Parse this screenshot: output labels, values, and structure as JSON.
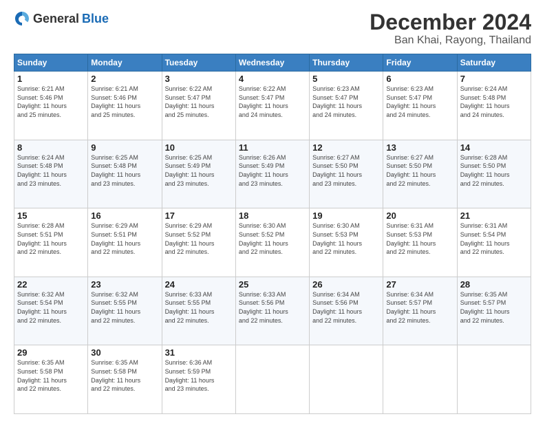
{
  "logo": {
    "general": "General",
    "blue": "Blue"
  },
  "header": {
    "month": "December 2024",
    "location": "Ban Khai, Rayong, Thailand"
  },
  "weekdays": [
    "Sunday",
    "Monday",
    "Tuesday",
    "Wednesday",
    "Thursday",
    "Friday",
    "Saturday"
  ],
  "weeks": [
    [
      {
        "day": "1",
        "sunrise": "6:21 AM",
        "sunset": "5:46 PM",
        "daylight": "11 hours and 25 minutes."
      },
      {
        "day": "2",
        "sunrise": "6:21 AM",
        "sunset": "5:46 PM",
        "daylight": "11 hours and 25 minutes."
      },
      {
        "day": "3",
        "sunrise": "6:22 AM",
        "sunset": "5:47 PM",
        "daylight": "11 hours and 25 minutes."
      },
      {
        "day": "4",
        "sunrise": "6:22 AM",
        "sunset": "5:47 PM",
        "daylight": "11 hours and 24 minutes."
      },
      {
        "day": "5",
        "sunrise": "6:23 AM",
        "sunset": "5:47 PM",
        "daylight": "11 hours and 24 minutes."
      },
      {
        "day": "6",
        "sunrise": "6:23 AM",
        "sunset": "5:47 PM",
        "daylight": "11 hours and 24 minutes."
      },
      {
        "day": "7",
        "sunrise": "6:24 AM",
        "sunset": "5:48 PM",
        "daylight": "11 hours and 24 minutes."
      }
    ],
    [
      {
        "day": "8",
        "sunrise": "6:24 AM",
        "sunset": "5:48 PM",
        "daylight": "11 hours and 23 minutes."
      },
      {
        "day": "9",
        "sunrise": "6:25 AM",
        "sunset": "5:48 PM",
        "daylight": "11 hours and 23 minutes."
      },
      {
        "day": "10",
        "sunrise": "6:25 AM",
        "sunset": "5:49 PM",
        "daylight": "11 hours and 23 minutes."
      },
      {
        "day": "11",
        "sunrise": "6:26 AM",
        "sunset": "5:49 PM",
        "daylight": "11 hours and 23 minutes."
      },
      {
        "day": "12",
        "sunrise": "6:27 AM",
        "sunset": "5:50 PM",
        "daylight": "11 hours and 23 minutes."
      },
      {
        "day": "13",
        "sunrise": "6:27 AM",
        "sunset": "5:50 PM",
        "daylight": "11 hours and 22 minutes."
      },
      {
        "day": "14",
        "sunrise": "6:28 AM",
        "sunset": "5:50 PM",
        "daylight": "11 hours and 22 minutes."
      }
    ],
    [
      {
        "day": "15",
        "sunrise": "6:28 AM",
        "sunset": "5:51 PM",
        "daylight": "11 hours and 22 minutes."
      },
      {
        "day": "16",
        "sunrise": "6:29 AM",
        "sunset": "5:51 PM",
        "daylight": "11 hours and 22 minutes."
      },
      {
        "day": "17",
        "sunrise": "6:29 AM",
        "sunset": "5:52 PM",
        "daylight": "11 hours and 22 minutes."
      },
      {
        "day": "18",
        "sunrise": "6:30 AM",
        "sunset": "5:52 PM",
        "daylight": "11 hours and 22 minutes."
      },
      {
        "day": "19",
        "sunrise": "6:30 AM",
        "sunset": "5:53 PM",
        "daylight": "11 hours and 22 minutes."
      },
      {
        "day": "20",
        "sunrise": "6:31 AM",
        "sunset": "5:53 PM",
        "daylight": "11 hours and 22 minutes."
      },
      {
        "day": "21",
        "sunrise": "6:31 AM",
        "sunset": "5:54 PM",
        "daylight": "11 hours and 22 minutes."
      }
    ],
    [
      {
        "day": "22",
        "sunrise": "6:32 AM",
        "sunset": "5:54 PM",
        "daylight": "11 hours and 22 minutes."
      },
      {
        "day": "23",
        "sunrise": "6:32 AM",
        "sunset": "5:55 PM",
        "daylight": "11 hours and 22 minutes."
      },
      {
        "day": "24",
        "sunrise": "6:33 AM",
        "sunset": "5:55 PM",
        "daylight": "11 hours and 22 minutes."
      },
      {
        "day": "25",
        "sunrise": "6:33 AM",
        "sunset": "5:56 PM",
        "daylight": "11 hours and 22 minutes."
      },
      {
        "day": "26",
        "sunrise": "6:34 AM",
        "sunset": "5:56 PM",
        "daylight": "11 hours and 22 minutes."
      },
      {
        "day": "27",
        "sunrise": "6:34 AM",
        "sunset": "5:57 PM",
        "daylight": "11 hours and 22 minutes."
      },
      {
        "day": "28",
        "sunrise": "6:35 AM",
        "sunset": "5:57 PM",
        "daylight": "11 hours and 22 minutes."
      }
    ],
    [
      {
        "day": "29",
        "sunrise": "6:35 AM",
        "sunset": "5:58 PM",
        "daylight": "11 hours and 22 minutes."
      },
      {
        "day": "30",
        "sunrise": "6:35 AM",
        "sunset": "5:58 PM",
        "daylight": "11 hours and 22 minutes."
      },
      {
        "day": "31",
        "sunrise": "6:36 AM",
        "sunset": "5:59 PM",
        "daylight": "11 hours and 23 minutes."
      },
      null,
      null,
      null,
      null
    ]
  ]
}
